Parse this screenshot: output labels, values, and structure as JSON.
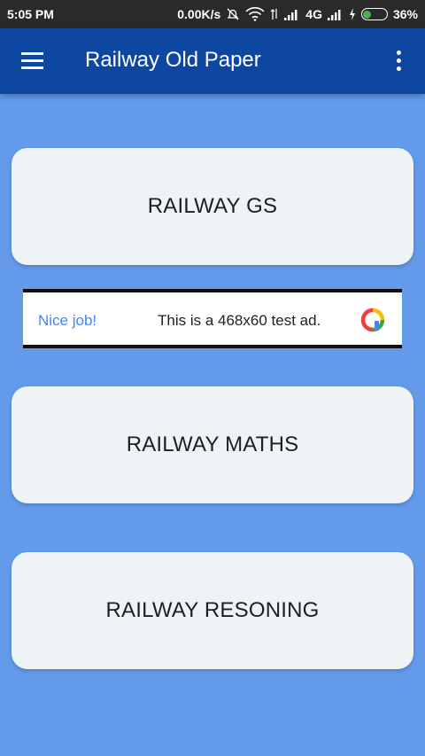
{
  "status_bar": {
    "time": "5:05 PM",
    "speed": "0.00K/s",
    "network": "4G",
    "battery": "36%"
  },
  "app_bar": {
    "title": "Railway Old Paper",
    "menu_icon": "hamburger-menu-icon",
    "overflow_icon": "more-vert-icon"
  },
  "cards": [
    {
      "label": "RAILWAY GS"
    },
    {
      "label": "RAILWAY MATHS"
    },
    {
      "label": "RAILWAY RESONING"
    }
  ],
  "ad": {
    "nice_job": "Nice job!",
    "text": "This is a 468x60 test ad."
  },
  "colors": {
    "background": "#639BEA",
    "app_bar": "#0D47A1",
    "status_bar": "#2A2A2A",
    "card": "#EEF3F6",
    "battery_fill": "#4CAF50",
    "ad_link": "#4285F4"
  }
}
